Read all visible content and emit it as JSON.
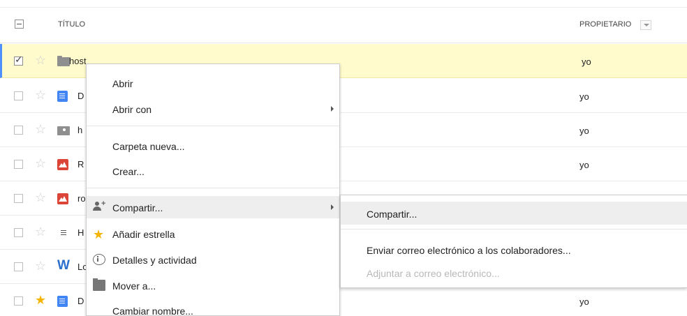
{
  "header": {
    "title_label": "TÍTULO",
    "owner_label": "PROPIETARIO"
  },
  "rows": [
    {
      "name": "host",
      "owner": "yo",
      "icon": "folder-icon",
      "starred": false,
      "selected": true
    },
    {
      "name": "D",
      "owner": "yo",
      "icon": "document-icon",
      "starred": false,
      "selected": false
    },
    {
      "name": "h",
      "owner": "yo",
      "icon": "shared-folder-icon",
      "starred": false,
      "selected": false
    },
    {
      "name": "R",
      "owner": "yo",
      "icon": "image-icon",
      "starred": false,
      "selected": false
    },
    {
      "name": "ro",
      "owner": "",
      "icon": "image-icon",
      "starred": false,
      "selected": false
    },
    {
      "name": "H",
      "owner": "",
      "icon": "text-file-icon",
      "starred": false,
      "selected": false
    },
    {
      "name": "Lo",
      "owner": "",
      "icon": "word-icon",
      "starred": false,
      "selected": false
    },
    {
      "name": "D",
      "owner": "yo",
      "icon": "document-icon",
      "starred": true,
      "selected": false
    }
  ],
  "context_menu": {
    "open": "Abrir",
    "open_with": "Abrir con",
    "new_folder": "Carpeta nueva...",
    "create": "Crear...",
    "share": "Compartir...",
    "add_star": "Añadir estrella",
    "details": "Detalles y actividad",
    "move_to": "Mover a...",
    "rename": "Cambiar nombre..."
  },
  "share_submenu": {
    "share": "Compartir...",
    "email_collaborators": "Enviar correo electrónico a los colaboradores...",
    "attach_email": "Adjuntar a correo electrónico..."
  },
  "colors": {
    "selected_row": "#fffbcd",
    "accent": "#4d90fe",
    "star": "#f4b400"
  }
}
